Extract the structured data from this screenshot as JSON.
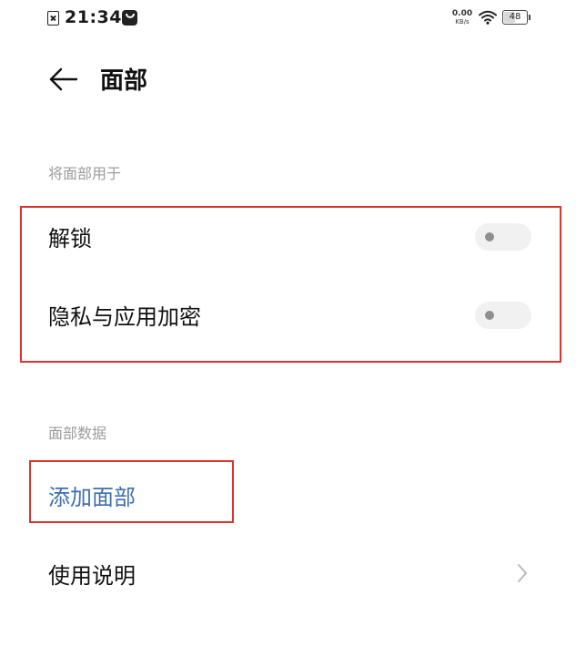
{
  "status_bar": {
    "time": "21:34",
    "net_speed_value": "0.00",
    "net_speed_unit": "KB/s",
    "battery_level": "48",
    "icons": [
      "sim-disabled-icon",
      "notification-icon",
      "wifi-icon",
      "battery-icon"
    ]
  },
  "header": {
    "title": "面部",
    "back_icon": "arrow-left-icon"
  },
  "sections": {
    "use_for": {
      "label": "将面部用于",
      "items": [
        {
          "label": "解锁",
          "toggle_on": false
        },
        {
          "label": "隐私与应用加密",
          "toggle_on": false
        }
      ]
    },
    "face_data": {
      "label": "面部数据",
      "add_face_label": "添加面部",
      "usage_label": "使用说明"
    }
  },
  "colors": {
    "link": "#3e6fb0",
    "highlight": "#d9352f",
    "section_label": "#9c9c9c",
    "toggle_track": "#f1f1f1",
    "toggle_knob": "#8f8f8f"
  }
}
